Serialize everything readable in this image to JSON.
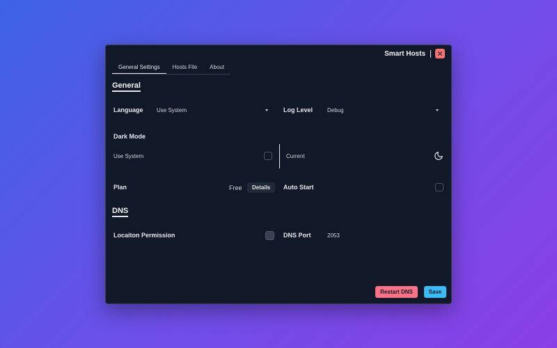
{
  "window": {
    "title": "Smart Hosts"
  },
  "tabs": [
    {
      "label": "General Settings",
      "active": true
    },
    {
      "label": "Hosts File",
      "active": false
    },
    {
      "label": "About",
      "active": false
    }
  ],
  "general": {
    "title": "General",
    "language": {
      "label": "Language",
      "value": "Use System"
    },
    "log_level": {
      "label": "Log Level",
      "value": "Debug"
    },
    "dark_mode": {
      "label": "Dark Mode",
      "use_system_label": "Use System",
      "use_system_checked": false,
      "current_label": "Current",
      "current_icon": "moon-icon"
    },
    "plan": {
      "label": "Plan",
      "value": "Free",
      "details_label": "Details"
    },
    "auto_start": {
      "label": "Auto Start",
      "checked": false
    }
  },
  "dns": {
    "title": "DNS",
    "location_permission": {
      "label": "Locaiton Permission",
      "checked": true
    },
    "dns_port": {
      "label": "DNS Port",
      "value": "2053"
    }
  },
  "actions": {
    "restart_label": "Restart DNS",
    "save_label": "Save"
  },
  "colors": {
    "accent_save": "#38bdf8",
    "accent_restart": "#fb7185",
    "close": "#f87171",
    "background": "#111827"
  }
}
